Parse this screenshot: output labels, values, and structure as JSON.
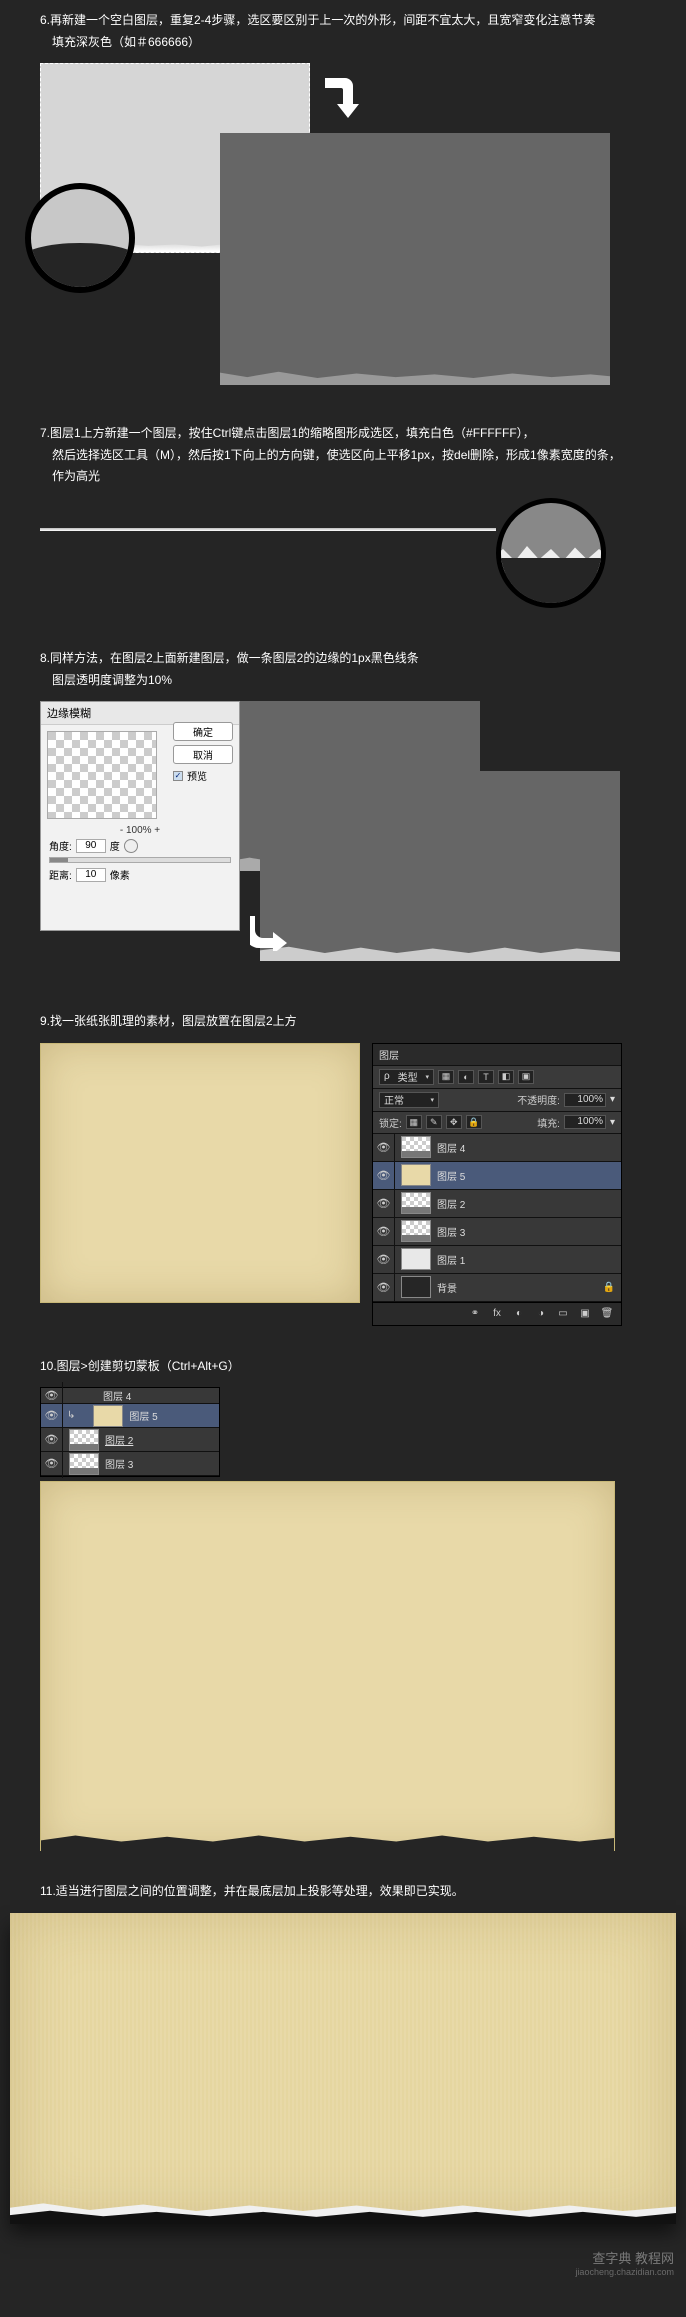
{
  "step6": {
    "caption_line1": "6.再新建一个空白图层，重复2-4步骤，选区要区别于上一次的外形，间距不宜太大，且宽窄变化注意节奏",
    "caption_line2": "填充深灰色（如＃666666）"
  },
  "step7": {
    "caption_line1": "7.图层1上方新建一个图层，按住Ctrl键点击图层1的缩略图形成选区，填充白色（#FFFFFF），",
    "caption_line2": "然后选择选区工具（M），然后按1下向上的方向键，使选区向上平移1px，按del删除，形成1像素宽度的条，",
    "caption_line3": "作为高光"
  },
  "step8": {
    "caption_line1": "8.同样方法，在图层2上面新建图层，做一条图层2的边缘的1px黑色线条",
    "caption_line2": "图层透明度调整为10%",
    "dialog_title": "边缘模糊",
    "btn_ok": "确定",
    "btn_cancel": "取消",
    "chk_preview": "预览",
    "angle_label": "角度:",
    "angle_value": "90",
    "angle_unit": "度",
    "distance_label": "距离:",
    "distance_value": "10",
    "distance_unit": "像素"
  },
  "step9": {
    "caption": "9.找一张纸张肌理的素材，图层放置在图层2上方",
    "panel_title": "图层",
    "type_label": "类型",
    "blend_mode": "正常",
    "opacity_label": "不透明度:",
    "opacity_value": "100%",
    "lock_label": "锁定:",
    "fill_label": "填充:",
    "fill_value": "100%",
    "layers": [
      {
        "name": "图层 4",
        "thumb": "checker",
        "selected": false
      },
      {
        "name": "图层 5",
        "thumb": "paper-th",
        "selected": true
      },
      {
        "name": "图层 2",
        "thumb": "checker",
        "selected": false
      },
      {
        "name": "图层 3",
        "thumb": "checker",
        "selected": false
      },
      {
        "name": "图层 1",
        "thumb": "white-th",
        "selected": false
      },
      {
        "name": "背景",
        "thumb": "bg-th",
        "selected": false,
        "locked": true
      }
    ]
  },
  "step10": {
    "caption": "10.图层>创建剪切蒙板（Ctrl+Alt+G）",
    "row_top": "图层 4",
    "layers": [
      {
        "name": "图层 5",
        "thumb": "paper-th",
        "indent": true
      },
      {
        "name": "图层 2",
        "thumb": "checker",
        "underline": true
      },
      {
        "name": "图层 3",
        "thumb": "checker"
      }
    ]
  },
  "step11": {
    "caption": "11.适当进行图层之间的位置调整，并在最底层加上投影等处理，效果即已实现。"
  },
  "watermark": {
    "line1": "查字典 教程网",
    "line2": "jiaocheng.chazidian.com"
  }
}
